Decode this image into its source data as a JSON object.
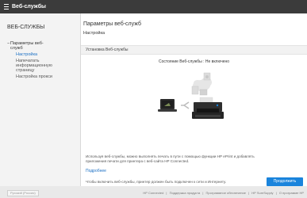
{
  "header": {
    "title": "Веб-службы"
  },
  "sidebar": {
    "title": "ВЕБ-СЛУЖБЫ",
    "parent_line1": "Параметры веб-",
    "parent_line2": "служб",
    "items": [
      {
        "label": "Настройка",
        "active": true
      },
      {
        "label_lines": [
          "Напечатать",
          "информационную",
          "страницу"
        ]
      },
      {
        "label": "Настройка прокси"
      }
    ]
  },
  "main": {
    "title": "Параметры веб-служб",
    "subtitle": "Настройка",
    "section_label": "Установка Веб-службы",
    "status_text": "Состояние Веб-службы : Не включено",
    "description_line1": "Используя веб-службы, можно выполнять печать в пути с помощью функции HP ePrint и добавлять",
    "description_line2": "приложения печати для принтера с веб-сайта HP Connected.",
    "more_link": "Подробнее",
    "note": "Чтобы включить веб-службы, принтер должен быть подключен к сети и Интернету.",
    "continue_button": "Продолжить"
  },
  "footer": {
    "left_button": "Русский (Россия)",
    "links": [
      "HP Connected",
      "Поддержка продукта",
      "Программное обеспечение",
      "HP SureSupply",
      "О программе HP"
    ],
    "separator": "|"
  },
  "colors": {
    "accent": "#1a84dc",
    "link": "#1a6fc4",
    "topbar": "#3b3b3b"
  },
  "icons": {
    "menu": "hamburger-icon",
    "laptop": "laptop-icon",
    "cloud": "cloud-icon",
    "printer": "printer-icon"
  }
}
